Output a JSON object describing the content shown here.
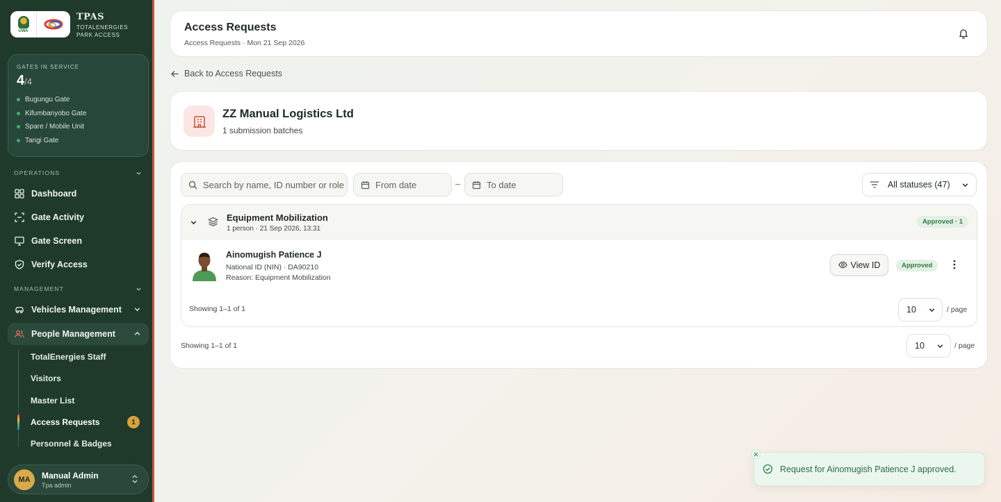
{
  "brand": {
    "uwa_text": "UWA",
    "name": "TPAS",
    "subtitle_line1": "TOTALENERGIES",
    "subtitle_line2": "PARK ACCESS"
  },
  "gates": {
    "label": "GATES IN SERVICE",
    "active": "4",
    "total": "/4",
    "list": [
      "Bugungu Gate",
      "Kifumbanyobo Gate",
      "Spare / Mobile Unit",
      "Tangi Gate"
    ]
  },
  "sidebar": {
    "operations_label": "OPERATIONS",
    "management_label": "MANAGEMENT",
    "operations": [
      {
        "label": "Dashboard",
        "icon": "grid-icon"
      },
      {
        "label": "Gate Activity",
        "icon": "scan-icon"
      },
      {
        "label": "Gate Screen",
        "icon": "monitor-icon"
      },
      {
        "label": "Verify Access",
        "icon": "shield-check-icon"
      }
    ],
    "management": [
      {
        "label": "Vehicles Management",
        "icon": "car-icon"
      },
      {
        "label": "People Management",
        "icon": "people-icon"
      }
    ],
    "people_sub": [
      {
        "label": "TotalEnergies Staff"
      },
      {
        "label": "Visitors"
      },
      {
        "label": "Master List"
      },
      {
        "label": "Access Requests",
        "badge": "1"
      },
      {
        "label": "Personnel & Badges"
      }
    ],
    "user": {
      "initials": "MA",
      "name": "Manual Admin",
      "role": "Tpa admin"
    }
  },
  "header": {
    "title": "Access Requests",
    "breadcrumb": "Access Requests · Mon 21 Sep 2026"
  },
  "back_link": "Back to Access Requests",
  "company": {
    "name": "ZZ Manual Logistics Ltd",
    "batches": "1 submission batches"
  },
  "filters": {
    "search_placeholder": "Search by name, ID number or role",
    "from_placeholder": "From date",
    "dash": "–",
    "to_placeholder": "To date",
    "status_label": "All statuses (47)"
  },
  "batch": {
    "title": "Equipment Mobilization",
    "meta": "1 person · 21 Sep 2026, 13:31",
    "status_badge": "Approved · 1",
    "person": {
      "name": "Ainomugish Patience J",
      "id_line": "National ID (NIN) · DA90210",
      "reason": "Reason: Equipment Mobilization",
      "view_label": "View ID",
      "status": "Approved"
    },
    "showing": "Showing 1–1 of 1",
    "page_size": "10",
    "per_page": "/ page"
  },
  "outer_pager": {
    "showing": "Showing 1–1 of 1",
    "page_size": "10",
    "per_page": "/ page"
  },
  "toast": {
    "message": "Request for Ainomugish Patience J approved."
  },
  "colors": {
    "sidebar_bg": "#1f3a2b",
    "accent_red": "#c8553a",
    "approved_green": "#2f7a45",
    "badge_gold": "#d7a23c"
  }
}
